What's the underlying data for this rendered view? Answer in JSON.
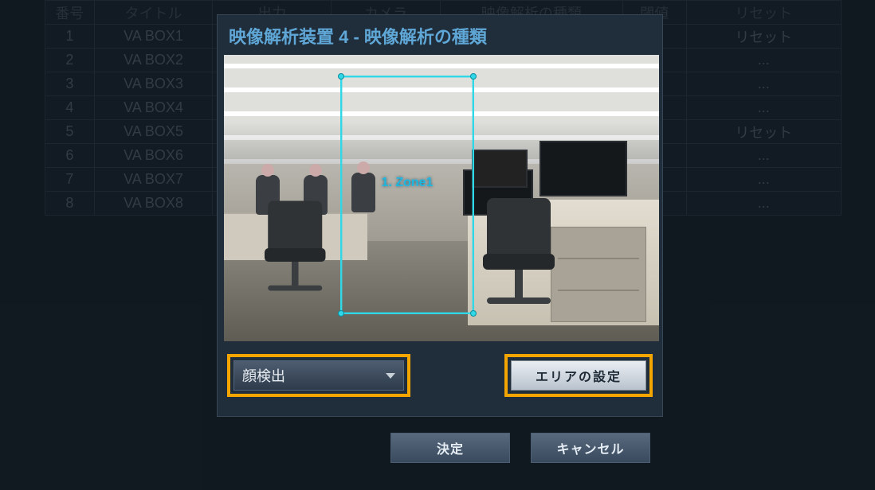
{
  "background_table": {
    "headers": [
      "番号",
      "タイトル",
      "出力",
      "カメラ",
      "映像解析の種類",
      "閾値",
      "リセット"
    ],
    "rows": [
      {
        "num": "1",
        "title": "VA BOX1",
        "reset": "リセット"
      },
      {
        "num": "2",
        "title": "VA BOX2",
        "reset": "..."
      },
      {
        "num": "3",
        "title": "VA BOX3",
        "reset": "..."
      },
      {
        "num": "4",
        "title": "VA BOX4",
        "reset": "..."
      },
      {
        "num": "5",
        "title": "VA BOX5",
        "reset": "リセット"
      },
      {
        "num": "6",
        "title": "VA BOX6",
        "reset": "..."
      },
      {
        "num": "7",
        "title": "VA BOX7",
        "reset": "..."
      },
      {
        "num": "8",
        "title": "VA BOX8",
        "reset": "..."
      }
    ]
  },
  "dialog": {
    "title": "映像解析装置 4 - 映像解析の種類",
    "zone_label": "1. Zone1",
    "dropdown_value": "顔検出",
    "area_button": "エリアの設定",
    "ok_button": "決定",
    "cancel_button": "キャンセル"
  }
}
